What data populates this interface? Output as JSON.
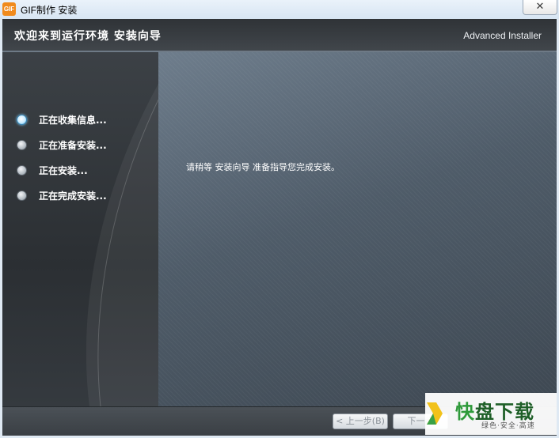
{
  "window": {
    "icon_text": "GIF",
    "title": "GIF制作 安装",
    "close_glyph": "✕"
  },
  "header": {
    "title": "欢迎来到运行环境 安装向导",
    "brand": "Advanced Installer"
  },
  "steps": [
    {
      "label": "正在收集信息...",
      "active": true
    },
    {
      "label": "正在准备安装...",
      "active": false
    },
    {
      "label": "正在安装...",
      "active": false
    },
    {
      "label": "正在完成安装...",
      "active": false
    }
  ],
  "main": {
    "message": "请稍等 安装向导 准备指导您完成安装。"
  },
  "footer": {
    "back_label": "< 上一步(B)",
    "next_label": "下一步"
  },
  "watermark": {
    "main_a": "快",
    "main_b": "盘下载",
    "sub": "绿色·安全·高速"
  },
  "colors": {
    "accent_radio": "#5cb5e8",
    "header_bg": "#3a3f44",
    "watermark_green": "#2e9a3a"
  }
}
